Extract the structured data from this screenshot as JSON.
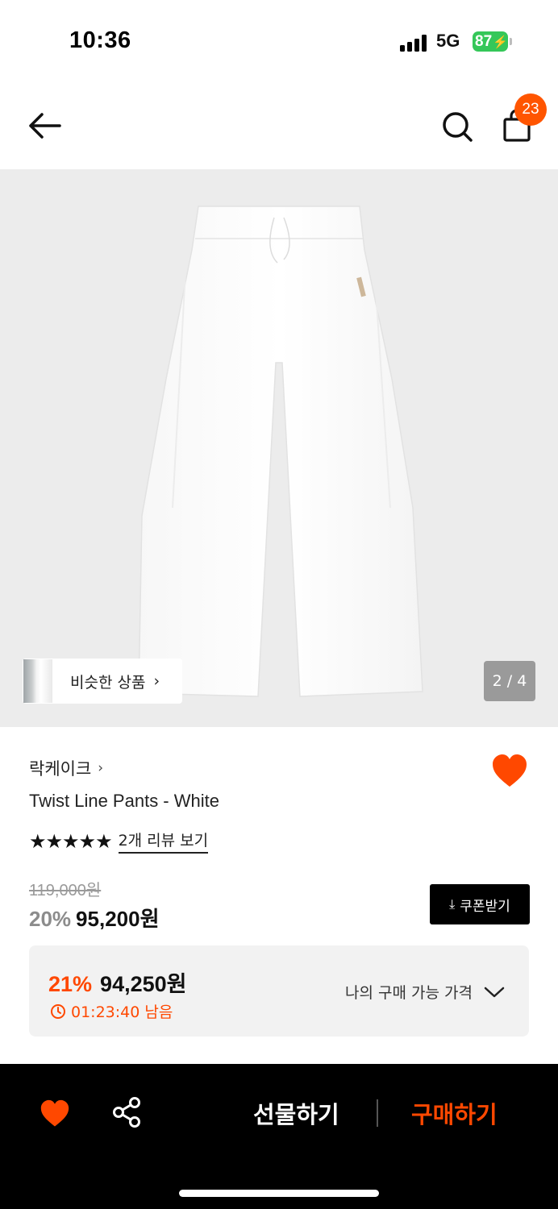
{
  "status_bar": {
    "time": "10:36",
    "network": "5G",
    "battery": "87"
  },
  "header": {
    "cart_count": "23"
  },
  "gallery": {
    "similar_label": "비슷한 상품",
    "page_indicator": "2 / 4"
  },
  "product": {
    "brand": "락케이크",
    "name": "Twist Line Pants - White",
    "review_link": "2개 리뷰 보기",
    "stars": "★★★★★",
    "original_price": "119,000원",
    "discount_rate": "20%",
    "sale_price": "95,200원",
    "coupon_label": "쿠폰받기"
  },
  "my_price": {
    "discount_rate": "21%",
    "price": "94,250원",
    "timer": "01:23:40 남음",
    "toggle_label": "나의 구매 가능 가격"
  },
  "bottom_bar": {
    "gift_label": "선물하기",
    "buy_label": "구매하기"
  },
  "colors": {
    "accent": "#ff4800",
    "badge": "#ff5500",
    "battery": "#35c759"
  }
}
